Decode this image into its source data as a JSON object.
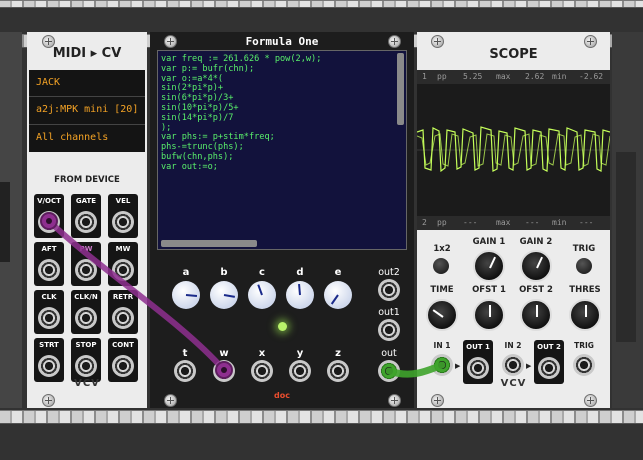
{
  "midi": {
    "title": "MIDI ▸ CV",
    "driver": "JACK",
    "device": "a2j:MPK mini [20]",
    "channel": "All channels",
    "section": "FROM DEVICE",
    "jacks": [
      "V/OCT",
      "GATE",
      "VEL",
      "AFT",
      "PW",
      "MW",
      "CLK",
      "CLK/N",
      "RETR",
      "STRT",
      "STOP",
      "CONT"
    ],
    "brand": "VCV"
  },
  "formula": {
    "title": "Formula One",
    "code": "var freq := 261.626 * pow(2,w);\nvar p:= bufr(chn);\nvar o:=a*4*(\nsin(2*pi*p)+\nsin(6*pi*p)/3+\nsin(10*pi*p)/5+\nsin(14*pi*p)/7\n);\nvar phs:= p+stim*freq;\nphs-=trunc(phs);\nbufw(chn,phs);\nvar out:=o;",
    "knob_labels": [
      "a",
      "b",
      "c",
      "d",
      "e"
    ],
    "input_labels": [
      "t",
      "w",
      "x",
      "y",
      "z"
    ],
    "out2": "out2",
    "out1": "out1",
    "out": "out",
    "brand": "doc"
  },
  "scope": {
    "title": "SCOPE",
    "ch1_num": "1",
    "ch1_pp_label": "pp",
    "ch1_pp": "5.25",
    "ch1_max_label": "max",
    "ch1_max": "2.62",
    "ch1_min_label": "min",
    "ch1_min": "-2.62",
    "ch2_num": "2",
    "ch2_pp_label": "pp",
    "ch2_pp": "---",
    "ch2_max_label": "max",
    "ch2_max": "---",
    "ch2_min_label": "min",
    "ch2_min": "---",
    "labels": {
      "x2": "1x2",
      "gain1": "GAIN 1",
      "gain2": "GAIN 2",
      "trig": "TRIG",
      "time": "TIME",
      "ofst1": "OFST 1",
      "ofst2": "OFST 2",
      "thres": "THRES",
      "in1": "IN 1",
      "out1": "OUT 1",
      "in2": "IN 2",
      "out2": "OUT 2",
      "trig_in": "TRIG"
    },
    "brand": "VCV"
  },
  "colors": {
    "cable_purple": "#8e2f8f",
    "cable_green": "#3fa42c",
    "scope_trace": "#c5ff5a",
    "code_text": "#59f06b"
  }
}
